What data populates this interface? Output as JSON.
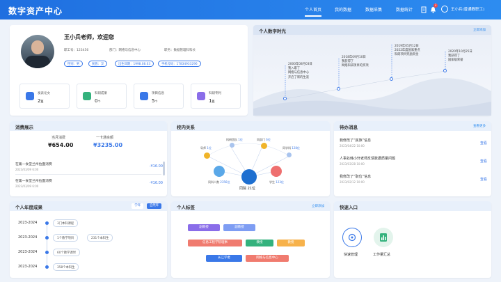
{
  "app": {
    "title": "数字资产中心"
  },
  "nav": [
    "个人首页",
    "我的数据",
    "数据采集",
    "数据统计"
  ],
  "header": {
    "badge": "3",
    "user": "王小兵(普通教职工)"
  },
  "profile": {
    "greeting": "王小兵老师，欢迎您",
    "id": "职工号：123456",
    "dept": "部门：网络与信息中心",
    "position": "职务：数据管理科科长",
    "chips": [
      "性别：男",
      "民族：汉",
      "出生日期：1998.08.03",
      "手机号码：17834933296"
    ]
  },
  "stats": [
    {
      "label": "发表论文",
      "value": "2",
      "unit": "篇",
      "color": "#3a78e8"
    },
    {
      "label": "科研成果",
      "value": "0",
      "unit": "个",
      "color": "#34b27d"
    },
    {
      "label": "项目信息",
      "value": "5",
      "unit": "个",
      "color": "#3a78e8"
    },
    {
      "label": "科研专利",
      "value": "1",
      "unit": "篇",
      "color": "#8a6de9"
    }
  ],
  "timeline": {
    "title": "个人数字时光",
    "link": "立即添加",
    "events": [
      {
        "date": "2000年08月03日",
        "l1": "我入职了",
        "l2": "网络与信息中心",
        "l3": "开启了新的生涯"
      },
      {
        "date": "2018年09月10日",
        "l1": "我获得了",
        "l2": "网络科研项目的奖项",
        "l3": ""
      },
      {
        "date": "2019年05月12日",
        "l1": "2022年度国家重点",
        "l2": "科研项目奖励资金",
        "l3": ""
      },
      {
        "date": "2020年10月25日",
        "l1": "我获得了",
        "l2": "国家级荣誉",
        "l3": ""
      }
    ]
  },
  "consumption": {
    "title": "消费展示",
    "current_label": "当月消费",
    "current_value": "¥654.00",
    "balance_label": "一卡通余额",
    "balance_value": "¥3235.00",
    "records": [
      {
        "name": "在第一食堂兰州拉面消费",
        "date": "2023/03/09  6:00",
        "amount": "-¥16.00"
      },
      {
        "name": "在第一食堂兰州拉面消费",
        "date": "2023/03/09  6:00",
        "amount": "-¥16.00"
      }
    ]
  },
  "relations": {
    "title": "校内关系",
    "nodes": [
      {
        "label": "同科人数",
        "value": "2356位"
      },
      {
        "label": "同院",
        "value": "21位"
      },
      {
        "label": "学生",
        "value": "123位"
      },
      {
        "label": "导师",
        "value": "1位"
      },
      {
        "label": "科研团队",
        "value": "1位"
      },
      {
        "label": "同部门",
        "value": "6位"
      },
      {
        "label": "同学科",
        "value": "128位"
      }
    ]
  },
  "todos": {
    "title": "待办消息",
    "link": "查看更多",
    "action": "查看",
    "items": [
      {
        "name": "我修改了“民族”信息",
        "date": "2023/04/22  10:00"
      },
      {
        "name": "人事处韩小轩老师反馈数据质量问题",
        "date": "2023/03/28  10:00"
      },
      {
        "name": "我修改了“职位”信息",
        "date": "2023/02/12  10:00"
      }
    ]
  },
  "achievements": {
    "title": "个人年度成果",
    "tabs": [
      "学年",
      "自然年"
    ],
    "rows": [
      {
        "year": "2023-2024",
        "items": [
          "3门本科课程"
        ]
      },
      {
        "year": "2023-2024",
        "items": [
          "1个教学项目",
          "231个本科生"
        ]
      },
      {
        "year": "2023-2024",
        "items": [
          "60个教学课时"
        ]
      },
      {
        "year": "2023-2024",
        "items": [
          "358个本科生"
        ]
      }
    ]
  },
  "tags": {
    "title": "个人标签",
    "link": "立即添加",
    "items": [
      {
        "text": "副教授",
        "color": "#8a6de9"
      },
      {
        "text": "副教授",
        "color": "#7e9df3"
      },
      {
        "text": "信息工程学院理事",
        "color": "#f07b6f"
      },
      {
        "text": "教授",
        "color": "#34b27d"
      },
      {
        "text": "教授",
        "color": "#f7b24b"
      },
      {
        "text": "长江学者",
        "color": "#3a78e8"
      },
      {
        "text": "网络与信息中心",
        "color": "#f07b6f"
      }
    ]
  },
  "quick": {
    "title": "快速入口",
    "items": [
      "快速管理",
      "工作量汇总"
    ]
  }
}
